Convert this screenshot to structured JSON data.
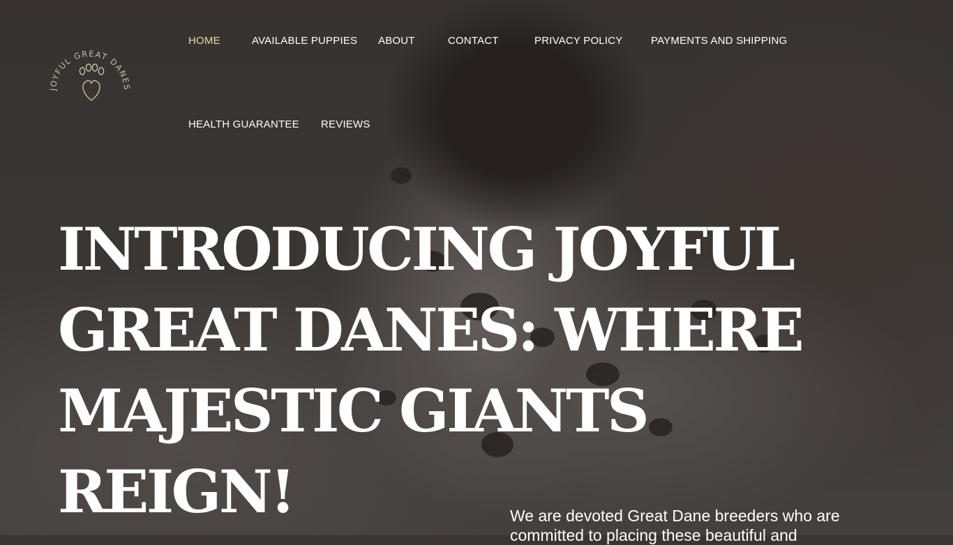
{
  "logo": {
    "text": "JOYFUL GREAT DANES",
    "icon": "paw-heart-icon",
    "color": "#c9bda6"
  },
  "nav": {
    "items": [
      {
        "label": "HOME",
        "active": true
      },
      {
        "label": "AVAILABLE PUPPIES"
      },
      {
        "label": "ABOUT"
      },
      {
        "label": "CONTACT"
      },
      {
        "label": "PRIVACY POLICY"
      },
      {
        "label": "PAYMENTS AND SHIPPING"
      },
      {
        "label": "HEALTH GUARANTEE"
      },
      {
        "label": "REVIEWS"
      }
    ],
    "active_color": "#e8d9a8"
  },
  "hero": {
    "title_lines": [
      "INTRODUCING JOYFUL",
      "GREAT DANES: WHERE",
      "MAJESTIC GIANTS REIGN!"
    ],
    "text": "We are devoted Great Dane breeders who are committed to placing these beautiful and"
  }
}
